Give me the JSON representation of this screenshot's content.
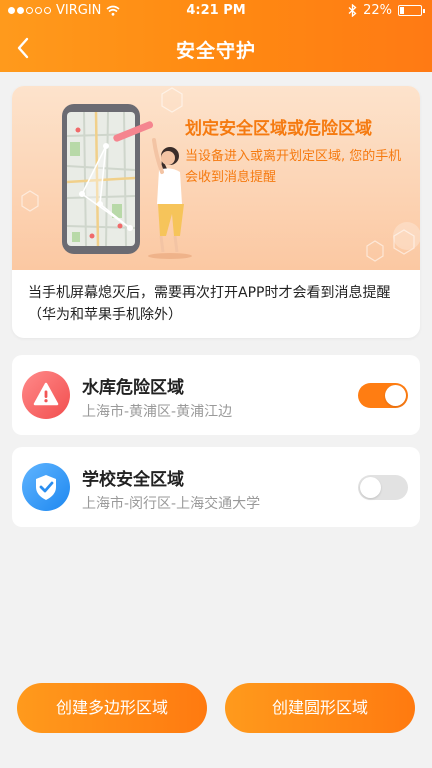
{
  "status_bar": {
    "carrier": "VIRGIN",
    "time": "4:21 PM",
    "battery": "22%",
    "battery_level": 0.22,
    "signal_bars": 2,
    "icons": [
      "wifi-icon",
      "bluetooth-icon",
      "battery-icon"
    ]
  },
  "header": {
    "title": "安全守护",
    "back_icon": "chevron-left-icon",
    "background_color": "#ff8a12"
  },
  "banner": {
    "title": "划定安全区域或危险区域",
    "description": "当设备进入或离开划定区域, 您的手机会收到消息提醒",
    "note": "当手机屏幕熄灭后，需要再次打开APP时才会看到消息提醒（华为和苹果手机除外）",
    "illustration": "phone-map-woman-illustration"
  },
  "zones": [
    {
      "name": "水库危险区域",
      "address": "上海市-黄浦区-黄浦江边",
      "type": "danger",
      "icon": "warning-icon",
      "enabled": true
    },
    {
      "name": "学校安全区域",
      "address": "上海市-闵行区-上海交通大学",
      "type": "safe",
      "icon": "shield-check-icon",
      "enabled": false
    }
  ],
  "actions": {
    "polygon_label": "创建多边形区域",
    "circle_label": "创建圆形区域"
  },
  "colors": {
    "accent": "#ff7d12",
    "danger": "#f24e4e",
    "safe": "#1e88f0",
    "toggle_off": "#e2e2e2"
  }
}
